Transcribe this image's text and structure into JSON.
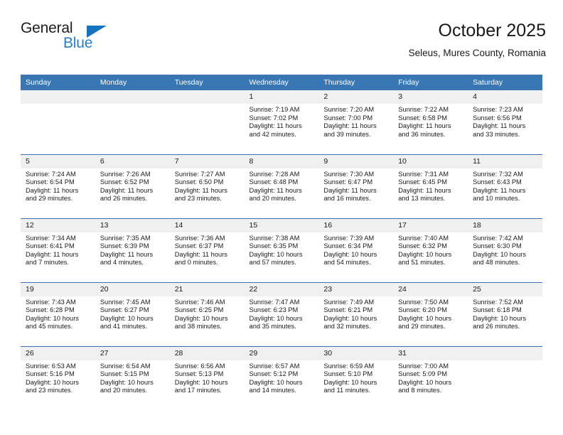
{
  "brand": {
    "name_part1": "General",
    "name_part2": "Blue",
    "accent_color": "#1572bd"
  },
  "header": {
    "title": "October 2025",
    "subtitle": "Seleus, Mures County, Romania",
    "header_bg_color": "#3877b4",
    "daynum_bg_color": "#f0f0f0"
  },
  "weekdays": [
    "Sunday",
    "Monday",
    "Tuesday",
    "Wednesday",
    "Thursday",
    "Friday",
    "Saturday"
  ],
  "labels": {
    "sunrise": "Sunrise:",
    "sunset": "Sunset:",
    "daylight": "Daylight:"
  },
  "weeks": [
    [
      {
        "day": "",
        "empty": true
      },
      {
        "day": "",
        "empty": true
      },
      {
        "day": "",
        "empty": true
      },
      {
        "day": "1",
        "sunrise": "Sunrise: 7:19 AM",
        "sunset": "Sunset: 7:02 PM",
        "daylight_1": "Daylight: 11 hours",
        "daylight_2": "and 42 minutes."
      },
      {
        "day": "2",
        "sunrise": "Sunrise: 7:20 AM",
        "sunset": "Sunset: 7:00 PM",
        "daylight_1": "Daylight: 11 hours",
        "daylight_2": "and 39 minutes."
      },
      {
        "day": "3",
        "sunrise": "Sunrise: 7:22 AM",
        "sunset": "Sunset: 6:58 PM",
        "daylight_1": "Daylight: 11 hours",
        "daylight_2": "and 36 minutes."
      },
      {
        "day": "4",
        "sunrise": "Sunrise: 7:23 AM",
        "sunset": "Sunset: 6:56 PM",
        "daylight_1": "Daylight: 11 hours",
        "daylight_2": "and 33 minutes."
      }
    ],
    [
      {
        "day": "5",
        "sunrise": "Sunrise: 7:24 AM",
        "sunset": "Sunset: 6:54 PM",
        "daylight_1": "Daylight: 11 hours",
        "daylight_2": "and 29 minutes."
      },
      {
        "day": "6",
        "sunrise": "Sunrise: 7:26 AM",
        "sunset": "Sunset: 6:52 PM",
        "daylight_1": "Daylight: 11 hours",
        "daylight_2": "and 26 minutes."
      },
      {
        "day": "7",
        "sunrise": "Sunrise: 7:27 AM",
        "sunset": "Sunset: 6:50 PM",
        "daylight_1": "Daylight: 11 hours",
        "daylight_2": "and 23 minutes."
      },
      {
        "day": "8",
        "sunrise": "Sunrise: 7:28 AM",
        "sunset": "Sunset: 6:48 PM",
        "daylight_1": "Daylight: 11 hours",
        "daylight_2": "and 20 minutes."
      },
      {
        "day": "9",
        "sunrise": "Sunrise: 7:30 AM",
        "sunset": "Sunset: 6:47 PM",
        "daylight_1": "Daylight: 11 hours",
        "daylight_2": "and 16 minutes."
      },
      {
        "day": "10",
        "sunrise": "Sunrise: 7:31 AM",
        "sunset": "Sunset: 6:45 PM",
        "daylight_1": "Daylight: 11 hours",
        "daylight_2": "and 13 minutes."
      },
      {
        "day": "11",
        "sunrise": "Sunrise: 7:32 AM",
        "sunset": "Sunset: 6:43 PM",
        "daylight_1": "Daylight: 11 hours",
        "daylight_2": "and 10 minutes."
      }
    ],
    [
      {
        "day": "12",
        "sunrise": "Sunrise: 7:34 AM",
        "sunset": "Sunset: 6:41 PM",
        "daylight_1": "Daylight: 11 hours",
        "daylight_2": "and 7 minutes."
      },
      {
        "day": "13",
        "sunrise": "Sunrise: 7:35 AM",
        "sunset": "Sunset: 6:39 PM",
        "daylight_1": "Daylight: 11 hours",
        "daylight_2": "and 4 minutes."
      },
      {
        "day": "14",
        "sunrise": "Sunrise: 7:36 AM",
        "sunset": "Sunset: 6:37 PM",
        "daylight_1": "Daylight: 11 hours",
        "daylight_2": "and 0 minutes."
      },
      {
        "day": "15",
        "sunrise": "Sunrise: 7:38 AM",
        "sunset": "Sunset: 6:35 PM",
        "daylight_1": "Daylight: 10 hours",
        "daylight_2": "and 57 minutes."
      },
      {
        "day": "16",
        "sunrise": "Sunrise: 7:39 AM",
        "sunset": "Sunset: 6:34 PM",
        "daylight_1": "Daylight: 10 hours",
        "daylight_2": "and 54 minutes."
      },
      {
        "day": "17",
        "sunrise": "Sunrise: 7:40 AM",
        "sunset": "Sunset: 6:32 PM",
        "daylight_1": "Daylight: 10 hours",
        "daylight_2": "and 51 minutes."
      },
      {
        "day": "18",
        "sunrise": "Sunrise: 7:42 AM",
        "sunset": "Sunset: 6:30 PM",
        "daylight_1": "Daylight: 10 hours",
        "daylight_2": "and 48 minutes."
      }
    ],
    [
      {
        "day": "19",
        "sunrise": "Sunrise: 7:43 AM",
        "sunset": "Sunset: 6:28 PM",
        "daylight_1": "Daylight: 10 hours",
        "daylight_2": "and 45 minutes."
      },
      {
        "day": "20",
        "sunrise": "Sunrise: 7:45 AM",
        "sunset": "Sunset: 6:27 PM",
        "daylight_1": "Daylight: 10 hours",
        "daylight_2": "and 41 minutes."
      },
      {
        "day": "21",
        "sunrise": "Sunrise: 7:46 AM",
        "sunset": "Sunset: 6:25 PM",
        "daylight_1": "Daylight: 10 hours",
        "daylight_2": "and 38 minutes."
      },
      {
        "day": "22",
        "sunrise": "Sunrise: 7:47 AM",
        "sunset": "Sunset: 6:23 PM",
        "daylight_1": "Daylight: 10 hours",
        "daylight_2": "and 35 minutes."
      },
      {
        "day": "23",
        "sunrise": "Sunrise: 7:49 AM",
        "sunset": "Sunset: 6:21 PM",
        "daylight_1": "Daylight: 10 hours",
        "daylight_2": "and 32 minutes."
      },
      {
        "day": "24",
        "sunrise": "Sunrise: 7:50 AM",
        "sunset": "Sunset: 6:20 PM",
        "daylight_1": "Daylight: 10 hours",
        "daylight_2": "and 29 minutes."
      },
      {
        "day": "25",
        "sunrise": "Sunrise: 7:52 AM",
        "sunset": "Sunset: 6:18 PM",
        "daylight_1": "Daylight: 10 hours",
        "daylight_2": "and 26 minutes."
      }
    ],
    [
      {
        "day": "26",
        "sunrise": "Sunrise: 6:53 AM",
        "sunset": "Sunset: 5:16 PM",
        "daylight_1": "Daylight: 10 hours",
        "daylight_2": "and 23 minutes."
      },
      {
        "day": "27",
        "sunrise": "Sunrise: 6:54 AM",
        "sunset": "Sunset: 5:15 PM",
        "daylight_1": "Daylight: 10 hours",
        "daylight_2": "and 20 minutes."
      },
      {
        "day": "28",
        "sunrise": "Sunrise: 6:56 AM",
        "sunset": "Sunset: 5:13 PM",
        "daylight_1": "Daylight: 10 hours",
        "daylight_2": "and 17 minutes."
      },
      {
        "day": "29",
        "sunrise": "Sunrise: 6:57 AM",
        "sunset": "Sunset: 5:12 PM",
        "daylight_1": "Daylight: 10 hours",
        "daylight_2": "and 14 minutes."
      },
      {
        "day": "30",
        "sunrise": "Sunrise: 6:59 AM",
        "sunset": "Sunset: 5:10 PM",
        "daylight_1": "Daylight: 10 hours",
        "daylight_2": "and 11 minutes."
      },
      {
        "day": "31",
        "sunrise": "Sunrise: 7:00 AM",
        "sunset": "Sunset: 5:09 PM",
        "daylight_1": "Daylight: 10 hours",
        "daylight_2": "and 8 minutes."
      },
      {
        "day": "",
        "empty": true
      }
    ]
  ]
}
